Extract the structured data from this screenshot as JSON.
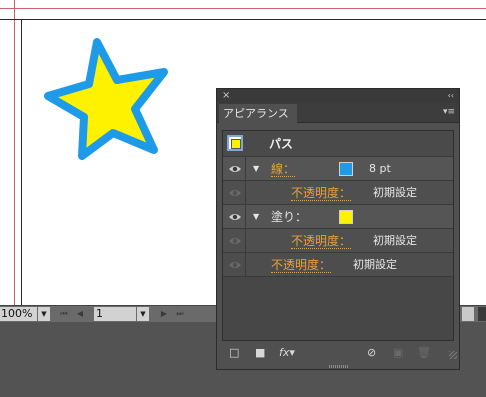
{
  "statusbar": {
    "zoom_value": "100%",
    "page_value": "1"
  },
  "panel": {
    "close_symbol": "×",
    "collapse_symbol": "‹‹",
    "tab_label": "アピアランス",
    "menu_symbol": "▾≡",
    "header_label": "パス",
    "stroke": {
      "label": "線：",
      "color": "#1e9be8",
      "weight": "8 pt",
      "opacity_label": "不透明度：",
      "opacity_value": "初期設定"
    },
    "fill": {
      "label": "塗り：",
      "color": "#fff200",
      "opacity_label": "不透明度：",
      "opacity_value": "初期設定"
    },
    "object_opacity": {
      "label": "不透明度：",
      "value": "初期設定"
    },
    "footer": {
      "add_stroke_icon": "□",
      "add_fill_icon": "■",
      "fx_icon": "fx▾",
      "clear_icon": "⊘",
      "duplicate_icon": "▣",
      "delete_icon": "🗑"
    }
  },
  "artwork": {
    "star_fill": "#fff200",
    "star_stroke": "#1e9be8"
  }
}
